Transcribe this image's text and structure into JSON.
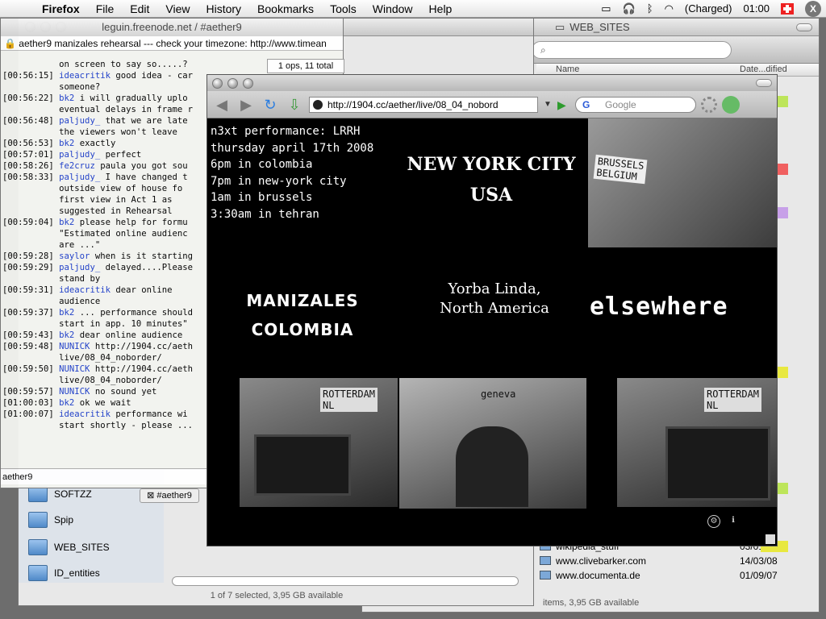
{
  "menubar": {
    "app": "Firefox",
    "items": [
      "File",
      "Edit",
      "View",
      "History",
      "Bookmarks",
      "Tools",
      "Window",
      "Help"
    ],
    "battery": "(Charged)",
    "clock": "01:00"
  },
  "finder": {
    "title": "WEB_SITES",
    "search_placeholder": "",
    "col_name": "Name",
    "col_date": "Date...dified",
    "rows": [
      {
        "name": "wikipedia_stuff",
        "date": "03/01/08"
      },
      {
        "name": "www.clivebarker.com",
        "date": "14/03/08"
      },
      {
        "name": "www.documenta.de",
        "date": "01/09/07"
      }
    ],
    "status": "items, 3,95 GB available"
  },
  "finder2": {
    "sidebar": [
      "SOFTZZ",
      "Spip",
      "WEB_SITES",
      "ID_entities"
    ],
    "status": "1 of 7 selected, 3,95 GB available"
  },
  "irc": {
    "title": "leguin.freenode.net / #aether9",
    "topic": "aether9 manizales rehearsal --- check your timezone: http://www.timean",
    "ops": "1 ops, 11 total",
    "lines": [
      {
        "t": "",
        "n": "",
        "m": "on screen to say so.....?"
      },
      {
        "t": "[00:56:15]",
        "n": "ideacritik",
        "m": "good idea - car"
      },
      {
        "t": "",
        "n": "",
        "m": "someone?"
      },
      {
        "t": "[00:56:22]",
        "n": "bk2",
        "m": "i will gradually uplo"
      },
      {
        "t": "",
        "n": "",
        "m": "eventual delays in frame r"
      },
      {
        "t": "[00:56:48]",
        "n": "paljudy_",
        "m": "that we are late"
      },
      {
        "t": "",
        "n": "",
        "m": "the viewers won't leave"
      },
      {
        "t": "[00:56:53]",
        "n": "bk2",
        "m": "exactly"
      },
      {
        "t": "[00:57:01]",
        "n": "paljudy_",
        "m": "perfect"
      },
      {
        "t": "[00:58:26]",
        "n": "fe2cruz",
        "m": "paula you got sou"
      },
      {
        "t": "[00:58:33]",
        "n": "paljudy_",
        "m": "I have changed t"
      },
      {
        "t": "",
        "n": "",
        "m": "outside view of house fo"
      },
      {
        "t": "",
        "n": "",
        "m": "first view in Act 1 as"
      },
      {
        "t": "",
        "n": "",
        "m": "suggested in Rehearsal"
      },
      {
        "t": "[00:59:04]",
        "n": "bk2",
        "m": "please help for formu"
      },
      {
        "t": "",
        "n": "",
        "m": "\"Estimated online audienc"
      },
      {
        "t": "",
        "n": "",
        "m": "are ...\""
      },
      {
        "t": "[00:59:28]",
        "n": "saylor",
        "m": "when is it starting"
      },
      {
        "t": "[00:59:29]",
        "n": "paljudy_",
        "m": "delayed....Please"
      },
      {
        "t": "",
        "n": "",
        "m": "stand by"
      },
      {
        "t": "[00:59:31]",
        "n": "ideacritik",
        "m": "dear online"
      },
      {
        "t": "",
        "n": "",
        "m": "audience"
      },
      {
        "t": "[00:59:37]",
        "n": "bk2",
        "m": "... performance should"
      },
      {
        "t": "",
        "n": "",
        "m": "start in app. 10 minutes\""
      },
      {
        "t": "[00:59:43]",
        "n": "bk2",
        "m": "dear online audience"
      },
      {
        "t": "[00:59:48]",
        "n": "NUNICK",
        "m": "http://1904.cc/aeth"
      },
      {
        "t": "",
        "n": "",
        "m": "live/08_04_noborder/"
      },
      {
        "t": "[00:59:50]",
        "n": "NUNICK",
        "m": "http://1904.cc/aeth"
      },
      {
        "t": "",
        "n": "",
        "m": "live/08_04_noborder/"
      },
      {
        "t": "[00:59:57]",
        "n": "NUNICK",
        "m": "no sound yet"
      },
      {
        "t": "[01:00:03]",
        "n": "bk2",
        "m": "ok we wait"
      },
      {
        "t": "[01:00:07]",
        "n": "ideacritik",
        "m": "performance wi"
      },
      {
        "t": "",
        "n": "",
        "m": "start shortly - please ..."
      }
    ],
    "input_nick": "aether9",
    "tab_label": "#aether9"
  },
  "firefox": {
    "url": "http://1904.cc/aether/live/08_04_nobord",
    "search_placeholder": "Google",
    "info_lines": [
      "n3xt performance: LRRH",
      "thursday april 17th 2008",
      "6pm in colombia",
      "7pm in new-york city",
      "1am in brussels",
      "3:30am in tehran"
    ],
    "nyc": [
      "NEW YORK CITY",
      "USA"
    ],
    "manizales": [
      "MANIZALES",
      "COLOMBIA"
    ],
    "yorba": [
      "Yorba Linda,",
      "North America"
    ],
    "elsewhere": "elsewhere",
    "cam_labels": {
      "brussels": [
        "BRUSSELS",
        "BELGIUM"
      ],
      "rotterdam": "ROTTERDAM",
      "nl": "NL",
      "geneva": "geneva"
    }
  }
}
